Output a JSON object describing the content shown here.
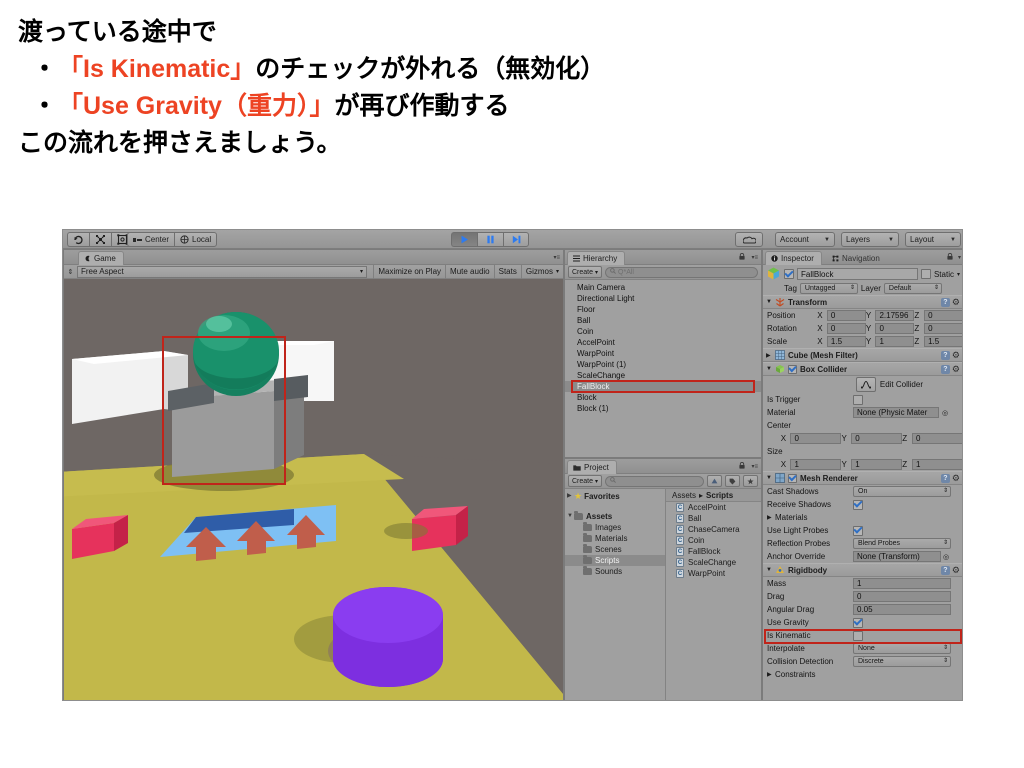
{
  "slide": {
    "lines": [
      {
        "text": "渡っている途中で",
        "bullet": false,
        "parts": [
          {
            "t": "渡っている途中で",
            "hl": false
          }
        ]
      },
      {
        "text": "・「Is Kinematic」のチェックが外れる（無効化）",
        "bullet": true
      },
      {
        "text": "・「Use Gravity（重力）」が再び作動する",
        "bullet": true
      },
      {
        "text": "この流れを押さえましょう。",
        "bullet": false
      }
    ],
    "line1": "渡っている途中で",
    "line2_hl": "「Is Kinematic」",
    "line2_rest": "のチェックが外れる（無効化）",
    "line3_hl": "「Use Gravity（重力）」",
    "line3_rest": "が再び作動する",
    "line4": "この流れを押さえましょう。",
    "bullet_char": "・",
    "highlight_color": "#ed4323",
    "text_color": "#000000"
  },
  "unity": {
    "toolbar": {
      "tools": [
        {
          "name": "rotate-tool",
          "icon": "rotate-icon"
        },
        {
          "name": "scale-tool",
          "icon": "scale-icon"
        },
        {
          "name": "rect-tool",
          "icon": "rect-icon"
        }
      ],
      "pivot_mode": "Center",
      "pivot_rotation": "Local",
      "play_label": "play-icon",
      "pause_label": "pause-icon",
      "step_label": "step-icon",
      "play_active": true,
      "cloud_icon": "cloud-icon",
      "account": "Account",
      "layers": "Layers",
      "layout": "Layout"
    },
    "game_panel": {
      "tab": "Game",
      "aspect": "Free Aspect",
      "maximize_on_play": "Maximize on Play",
      "mute_audio": "Mute audio",
      "stats": "Stats",
      "gizmos": "Gizmos"
    },
    "scene": {
      "floor_color": "#c2b84a",
      "background_color": "#6e6764",
      "wall_color": "#f2f2f2",
      "ball_color": "#17795e",
      "fallblock_color": "#9b9b9b",
      "red_box_color": "#e6325c",
      "cylinder_color": "#7d2fe0",
      "accel_panel_color": "#7ec0f4",
      "arrow_color": "#c05e4b",
      "warp_panel_color": "#2f5da8",
      "selection_outline_color": "#c0241a"
    },
    "hierarchy": {
      "tab": "Hierarchy",
      "create_label": "Create",
      "search_placeholder": "Q*All",
      "items": [
        {
          "label": "Main Camera",
          "selected": false
        },
        {
          "label": "Directional Light",
          "selected": false
        },
        {
          "label": "Floor",
          "selected": false
        },
        {
          "label": "Ball",
          "selected": false
        },
        {
          "label": "Coin",
          "selected": false
        },
        {
          "label": "AccelPoint",
          "selected": false
        },
        {
          "label": "WarpPoint",
          "selected": false
        },
        {
          "label": "WarpPoint (1)",
          "selected": false
        },
        {
          "label": "ScaleChange",
          "selected": false
        },
        {
          "label": "FallBlock",
          "selected": true
        },
        {
          "label": "Block",
          "selected": false
        },
        {
          "label": "Block (1)",
          "selected": false
        }
      ]
    },
    "project": {
      "tab": "Project",
      "create_label": "Create",
      "search_placeholder": "",
      "favorites_label": "Favorites",
      "assets_label": "Assets",
      "folders": [
        {
          "label": "Images",
          "selected": false
        },
        {
          "label": "Materials",
          "selected": false
        },
        {
          "label": "Scenes",
          "selected": false
        },
        {
          "label": "Scripts",
          "selected": true
        },
        {
          "label": "Sounds",
          "selected": false
        }
      ],
      "breadcrumb_root": "Assets",
      "breadcrumb_sep": "▸",
      "breadcrumb_leaf": "Scripts",
      "scripts": [
        "AccelPoint",
        "Ball",
        "ChaseCamera",
        "Coin",
        "FallBlock",
        "ScaleChange",
        "WarpPoint"
      ]
    },
    "inspector": {
      "tab": "Inspector",
      "nav_tab": "Navigation",
      "object_name": "FallBlock",
      "object_enabled": true,
      "static_label": "Static",
      "static_checked": false,
      "tag_label": "Tag",
      "tag_value": "Untagged",
      "layer_label": "Layer",
      "layer_value": "Default",
      "components": {
        "transform": {
          "title": "Transform",
          "rows": [
            {
              "label": "Position",
              "x": "0",
              "y": "2.17596",
              "z": "0"
            },
            {
              "label": "Rotation",
              "x": "0",
              "y": "0",
              "z": "0"
            },
            {
              "label": "Scale",
              "x": "1.5",
              "y": "1",
              "z": "1.5"
            }
          ]
        },
        "mesh_filter": {
          "title": "Cube (Mesh Filter)"
        },
        "box_collider": {
          "title": "Box Collider",
          "enabled": true,
          "edit_collider": "Edit Collider",
          "is_trigger_label": "Is Trigger",
          "is_trigger_checked": false,
          "material_label": "Material",
          "material_value": "None (Physic Mater",
          "center_label": "Center",
          "center": {
            "x": "0",
            "y": "0",
            "z": "0"
          },
          "size_label": "Size",
          "size": {
            "x": "1",
            "y": "1",
            "z": "1"
          }
        },
        "mesh_renderer": {
          "title": "Mesh Renderer",
          "enabled": true,
          "cast_shadows_label": "Cast Shadows",
          "cast_shadows_value": "On",
          "receive_shadows_label": "Receive Shadows",
          "receive_shadows_checked": true,
          "materials_label": "Materials",
          "use_light_probes_label": "Use Light Probes",
          "use_light_probes_checked": true,
          "reflection_probes_label": "Reflection Probes",
          "reflection_probes_value": "Blend Probes",
          "anchor_override_label": "Anchor Override",
          "anchor_override_value": "None (Transform)"
        },
        "rigidbody": {
          "title": "Rigidbody",
          "mass_label": "Mass",
          "mass_value": "1",
          "drag_label": "Drag",
          "drag_value": "0",
          "angular_drag_label": "Angular Drag",
          "angular_drag_value": "0.05",
          "use_gravity_label": "Use Gravity",
          "use_gravity_checked": true,
          "is_kinematic_label": "Is Kinematic",
          "is_kinematic_checked": false,
          "is_kinematic_highlighted": true,
          "interpolate_label": "Interpolate",
          "interpolate_value": "None",
          "collision_detection_label": "Collision Detection",
          "collision_detection_value": "Discrete",
          "constraints_label": "Constraints"
        }
      }
    }
  }
}
